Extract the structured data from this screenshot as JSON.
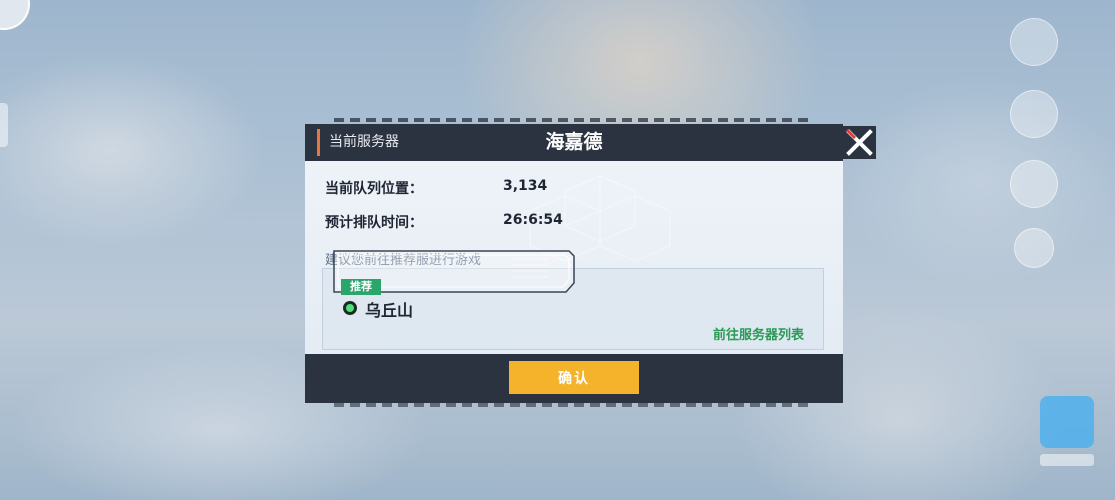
{
  "dialog": {
    "header_label": "当前服务器",
    "server_name": "海嘉德",
    "queue_position_label": "当前队列位置：",
    "queue_position_value": "3,134",
    "wait_time_label": "预计排队时间：",
    "wait_time_value": "26:6:54",
    "suggestion_text": "建议您前往推荐服进行游戏",
    "recommended": {
      "badge": "推荐",
      "server_name": "乌丘山",
      "status_color": "#4ee07a"
    },
    "goto_server_list": "前往服务器列表",
    "confirm_label": "确认"
  },
  "colors": {
    "header_bg": "#2c3340",
    "accent_orange": "#e8763c",
    "confirm_yellow": "#f4b32b",
    "link_green": "#2a9a55",
    "close_red": "#e23b3b"
  },
  "icons": {
    "close": "close-x-icon",
    "status": "online-status-dot-icon"
  }
}
